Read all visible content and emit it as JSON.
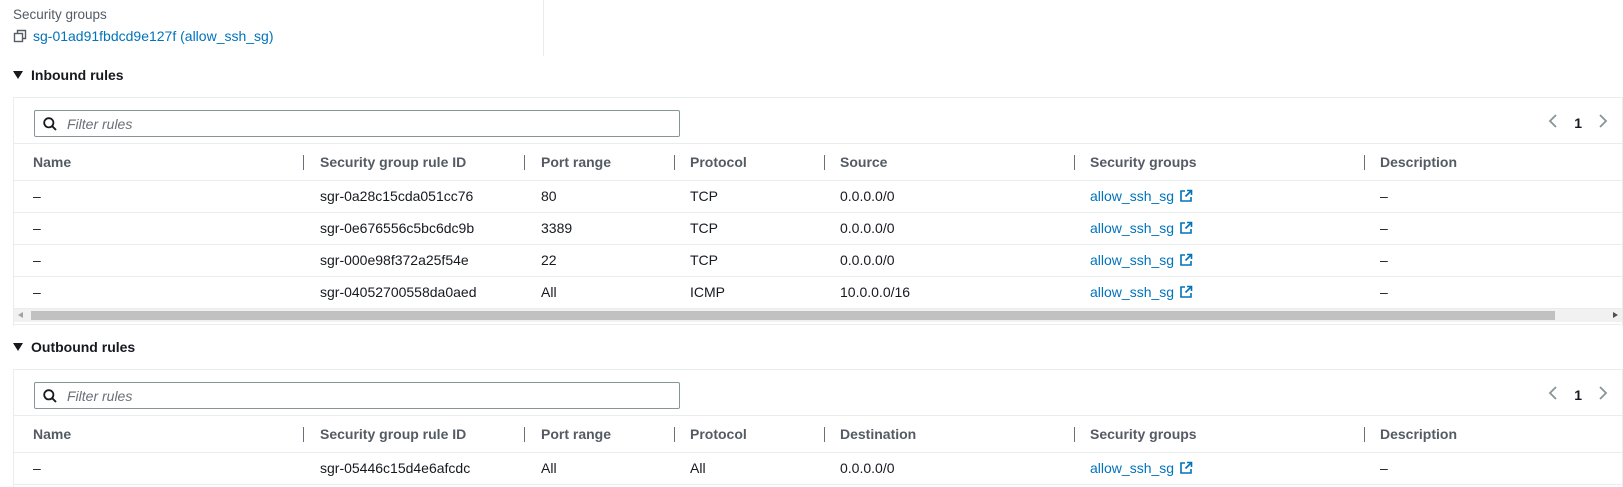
{
  "security_groups": {
    "label": "Security groups",
    "link_text": "sg-01ad91fbdcd9e127f (allow_ssh_sg)"
  },
  "inbound": {
    "title": "Inbound rules",
    "filter_placeholder": "Filter rules",
    "page": "1",
    "columns": [
      "Name",
      "Security group rule ID",
      "Port range",
      "Protocol",
      "Source",
      "Security groups",
      "Description"
    ],
    "rows": [
      {
        "name": "–",
        "rule_id": "sgr-0a28c15cda051cc76",
        "port_range": "80",
        "protocol": "TCP",
        "source": "0.0.0.0/0",
        "security_group": "allow_ssh_sg",
        "description": "–"
      },
      {
        "name": "–",
        "rule_id": "sgr-0e676556c5bc6dc9b",
        "port_range": "3389",
        "protocol": "TCP",
        "source": "0.0.0.0/0",
        "security_group": "allow_ssh_sg",
        "description": "–"
      },
      {
        "name": "–",
        "rule_id": "sgr-000e98f372a25f54e",
        "port_range": "22",
        "protocol": "TCP",
        "source": "0.0.0.0/0",
        "security_group": "allow_ssh_sg",
        "description": "–"
      },
      {
        "name": "–",
        "rule_id": "sgr-04052700558da0aed",
        "port_range": "All",
        "protocol": "ICMP",
        "source": "10.0.0.0/16",
        "security_group": "allow_ssh_sg",
        "description": "–"
      }
    ]
  },
  "outbound": {
    "title": "Outbound rules",
    "filter_placeholder": "Filter rules",
    "page": "1",
    "columns": [
      "Name",
      "Security group rule ID",
      "Port range",
      "Protocol",
      "Destination",
      "Security groups",
      "Description"
    ],
    "rows": [
      {
        "name": "–",
        "rule_id": "sgr-05446c15d4e6afcdc",
        "port_range": "All",
        "protocol": "All",
        "destination": "0.0.0.0/0",
        "security_group": "allow_ssh_sg",
        "description": "–"
      }
    ]
  },
  "colors": {
    "link": "#0073bb",
    "text": "#16191f",
    "header_text": "#545b64",
    "border": "#eaeded"
  },
  "icons": [
    "copy-icon",
    "search-icon",
    "chevron-left-icon",
    "chevron-right-icon",
    "external-link-icon",
    "caret-down-icon"
  ]
}
